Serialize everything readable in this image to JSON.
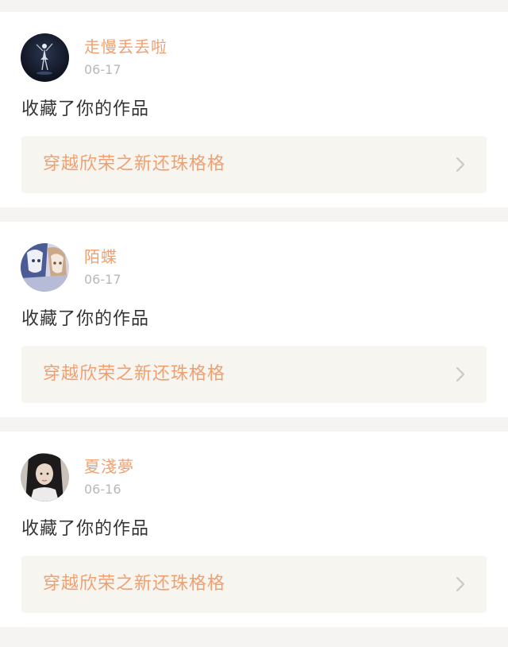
{
  "notifications": [
    {
      "username": "走慢丢丢啦",
      "date": "06-17",
      "action": "收藏了你的作品",
      "work_title": "穿越欣荣之新还珠格格",
      "avatar": "avatar-dark-dancer"
    },
    {
      "username": "陌蝶",
      "date": "06-17",
      "action": "收藏了你的作品",
      "work_title": "穿越欣荣之新还珠格格",
      "avatar": "avatar-anime-girls"
    },
    {
      "username": "夏淺夢",
      "date": "06-16",
      "action": "收藏了你的作品",
      "work_title": "穿越欣荣之新还珠格格",
      "avatar": "avatar-photo-girl"
    }
  ],
  "colors": {
    "page_bg": "#f5f4f2",
    "card_bg": "#ffffff",
    "accent": "#f0a070",
    "muted": "#b8b8b8",
    "text": "#333333",
    "link_bg": "#f6f5f0",
    "chevron": "#c8c8c8"
  },
  "icons": {
    "chevron": "chevron-right-icon"
  }
}
